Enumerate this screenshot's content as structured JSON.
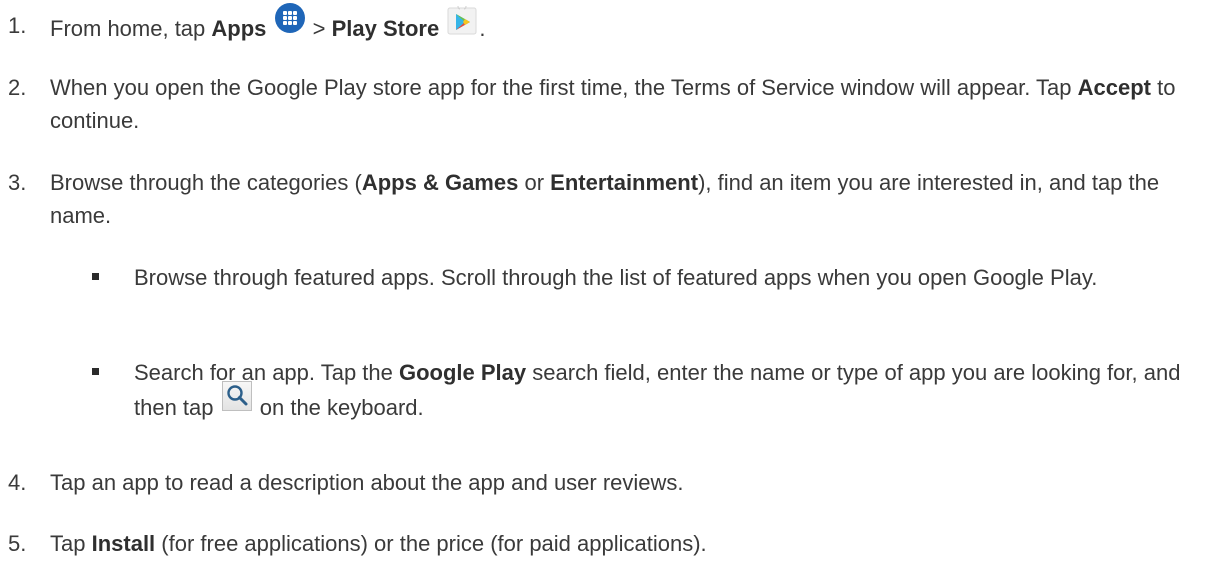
{
  "steps": [
    {
      "num": "1.",
      "pre": "From home, tap ",
      "apps": "Apps",
      "gt": " > ",
      "play_store": "Play Store",
      "end": "."
    },
    {
      "num": "2.",
      "pre": "When you open the Google Play store app for the first time, the Terms of Service window will appear. Tap ",
      "bold": "Accept",
      "post": " to continue."
    },
    {
      "num": "3.",
      "pre": "Browse through the categories (",
      "bold1": "Apps & Games",
      "mid": " or ",
      "bold2": "Entertainment",
      "post": "), find an item you are interested in, and tap the name."
    },
    {
      "num": "4.",
      "text": "Tap an app to read a description about the app and user reviews."
    },
    {
      "num": "5.",
      "pre": "Tap ",
      "bold": "Install",
      "post": " (for free applications) or the price (for paid applications)."
    }
  ],
  "sub_bullets": [
    {
      "text": "Browse through featured apps. Scroll through the list of featured apps when you open Google Play."
    },
    {
      "pre": "Search for an app. Tap the ",
      "bold": "Google Play",
      "mid": " search field, enter the name or type of app you are looking for, and then tap ",
      "post": " on the keyboard."
    }
  ],
  "icons": {
    "apps": "apps-grid-icon",
    "play_store": "play-store-icon",
    "search": "search-key-icon",
    "apps_color": "#1f66b8"
  }
}
